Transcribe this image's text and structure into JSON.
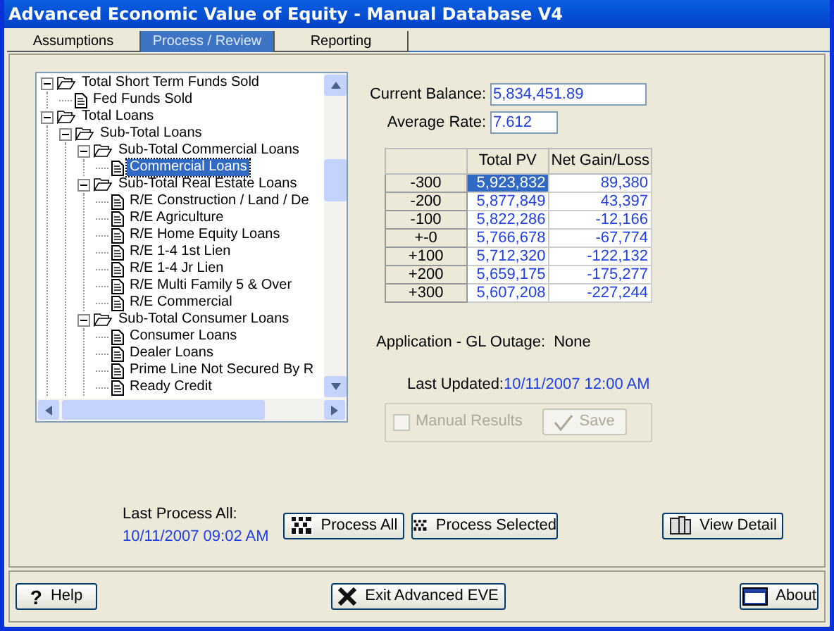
{
  "window": {
    "title": "Advanced Economic Value of Equity - Manual Database V4"
  },
  "tabs": [
    {
      "label": "Assumptions",
      "selected": false
    },
    {
      "label": "Process / Review",
      "selected": true
    },
    {
      "label": "Reporting",
      "selected": false
    }
  ],
  "tree": [
    {
      "label": "Total Short Term Funds Sold",
      "kind": "folder",
      "expanded": true,
      "selected": false,
      "children": [
        {
          "label": "Fed Funds Sold",
          "kind": "file",
          "selected": false
        }
      ]
    },
    {
      "label": "Total Loans",
      "kind": "folder",
      "expanded": true,
      "selected": false,
      "children": [
        {
          "label": "Sub-Total Loans",
          "kind": "folder",
          "expanded": true,
          "selected": false,
          "children": [
            {
              "label": "Sub-Total Commercial Loans",
              "kind": "folder",
              "expanded": true,
              "selected": false,
              "children": [
                {
                  "label": "Commercial Loans",
                  "kind": "file",
                  "selected": true
                }
              ]
            },
            {
              "label": "Sub-Total Real Estate Loans",
              "kind": "folder",
              "expanded": true,
              "selected": false,
              "children": [
                {
                  "label": "R/E Construction / Land / De",
                  "kind": "file",
                  "selected": false
                },
                {
                  "label": "R/E Agriculture",
                  "kind": "file",
                  "selected": false
                },
                {
                  "label": "R/E Home Equity Loans",
                  "kind": "file",
                  "selected": false
                },
                {
                  "label": "R/E 1-4 1st Lien",
                  "kind": "file",
                  "selected": false
                },
                {
                  "label": "R/E 1-4 Jr Lien",
                  "kind": "file",
                  "selected": false
                },
                {
                  "label": "R/E Multi Family 5 & Over",
                  "kind": "file",
                  "selected": false
                },
                {
                  "label": "R/E Commercial",
                  "kind": "file",
                  "selected": false
                }
              ]
            },
            {
              "label": "Sub-Total Consumer Loans",
              "kind": "folder",
              "expanded": true,
              "selected": false,
              "children": [
                {
                  "label": "Consumer Loans",
                  "kind": "file",
                  "selected": false
                },
                {
                  "label": "Dealer Loans",
                  "kind": "file",
                  "selected": false
                },
                {
                  "label": "Prime Line Not Secured By R",
                  "kind": "file",
                  "selected": false
                },
                {
                  "label": "Ready Credit",
                  "kind": "file",
                  "selected": false
                }
              ]
            }
          ]
        }
      ]
    }
  ],
  "fields": [
    {
      "label": "Current Balance:",
      "value": "5,834,451.89"
    },
    {
      "label": "Average Rate:",
      "value": "7.612"
    }
  ],
  "table": {
    "columns": [
      "Total PV",
      "Net Gain/Loss"
    ],
    "rows": [
      {
        "label": "-300",
        "cells": [
          "5,923,832",
          "89,380"
        ],
        "selected": true
      },
      {
        "label": "-200",
        "cells": [
          "5,877,849",
          "43,397"
        ],
        "selected": false
      },
      {
        "label": "-100",
        "cells": [
          "5,822,286",
          "-12,166"
        ],
        "selected": false
      },
      {
        "label": "+-0",
        "cells": [
          "5,766,678",
          "-67,774"
        ],
        "selected": false
      },
      {
        "label": "+100",
        "cells": [
          "5,712,320",
          "-122,132"
        ],
        "selected": false
      },
      {
        "label": "+200",
        "cells": [
          "5,659,175",
          "-175,277"
        ],
        "selected": false
      },
      {
        "label": "+300",
        "cells": [
          "5,607,208",
          "-227,244"
        ],
        "selected": false
      }
    ]
  },
  "outage": {
    "label": "Application - GL Outage:",
    "value": "None"
  },
  "last_updated": {
    "label": "Last Updated:",
    "value": "10/11/2007 12:00 AM"
  },
  "manual": {
    "label": "Manual Results",
    "checked": false,
    "disabled": true,
    "save": "Save"
  },
  "last_process": {
    "label": "Last Process All:",
    "value": "10/11/2007 09:02 AM"
  },
  "actions": [
    {
      "label": "Process All",
      "kind": "process"
    },
    {
      "label": "Process Selected",
      "kind": "process"
    },
    {
      "label": "View Detail",
      "kind": "detail"
    }
  ],
  "footer": [
    {
      "label": "Help",
      "kind": "help",
      "icon": "?"
    },
    {
      "label": "Exit Advanced EVE",
      "kind": "exit"
    },
    {
      "label": "About",
      "kind": "about"
    }
  ]
}
